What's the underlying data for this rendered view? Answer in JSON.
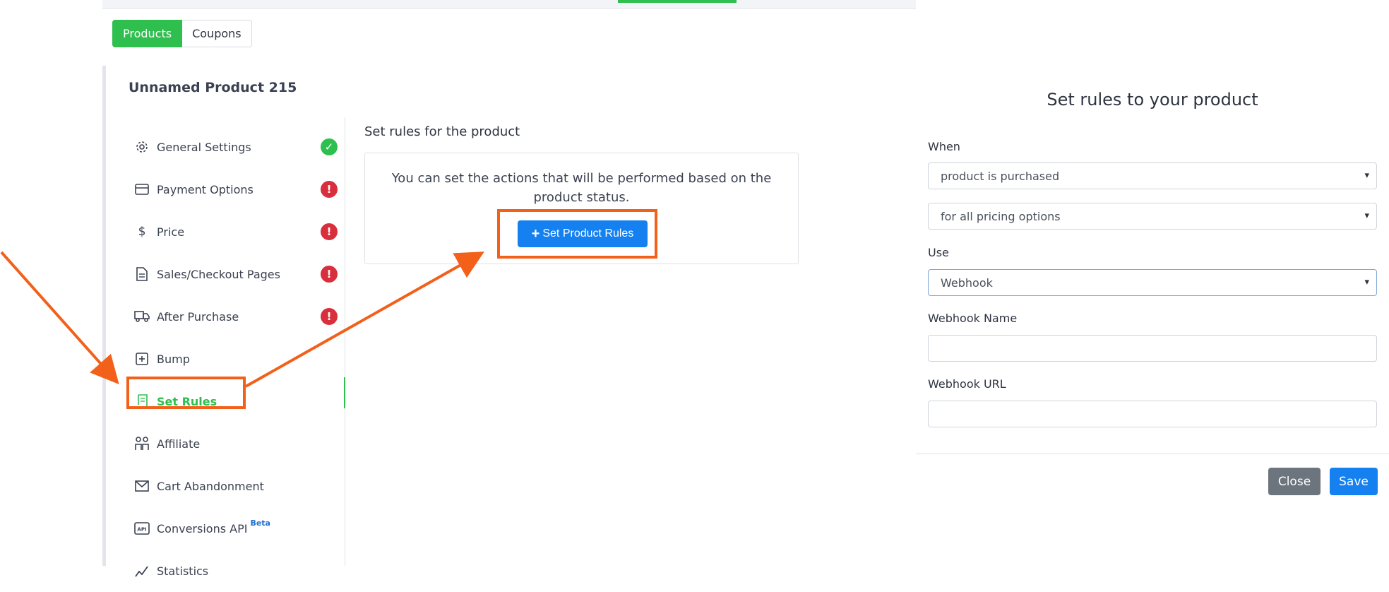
{
  "tabs": [
    {
      "label": "Products",
      "active": true
    },
    {
      "label": "Coupons",
      "active": false
    }
  ],
  "product": {
    "title": "Unnamed Product 215"
  },
  "nav": {
    "general_settings": {
      "label": "General Settings",
      "icon": "gear-icon",
      "status": "complete"
    },
    "payment_options": {
      "label": "Payment Options",
      "icon": "credit-card-icon",
      "status": "incomplete"
    },
    "price": {
      "label": "Price",
      "icon": "dollar-icon",
      "status": "incomplete"
    },
    "sales_checkout": {
      "label": "Sales/Checkout Pages",
      "icon": "document-icon",
      "status": "incomplete"
    },
    "after_purchase": {
      "label": "After Purchase",
      "icon": "truck-icon",
      "status": "incomplete"
    },
    "bump": {
      "label": "Bump",
      "icon": "plus-square-icon"
    },
    "set_rules": {
      "label": "Set Rules",
      "icon": "scroll-icon",
      "active": true
    },
    "affiliate": {
      "label": "Affiliate",
      "icon": "people-icon"
    },
    "cart_abandonment": {
      "label": "Cart Abandonment",
      "icon": "envelope-icon"
    },
    "conversions_api": {
      "label": "Conversions API",
      "icon": "api-icon",
      "badge": "Beta"
    },
    "statistics": {
      "label": "Statistics",
      "icon": "chart-icon"
    }
  },
  "content": {
    "section_title": "Set rules for the product",
    "info_text": "You can set the actions that will be performed based on the product status.",
    "set_rules_button": "Set Product Rules"
  },
  "modal": {
    "title": "Set rules to your product",
    "when_label": "When",
    "when_value": "product is purchased",
    "pricing_value": "for all pricing options",
    "use_label": "Use",
    "use_value": "Webhook",
    "webhook_name_label": "Webhook Name",
    "webhook_name_value": "",
    "webhook_url_label": "Webhook URL",
    "webhook_url_value": "",
    "close_label": "Close",
    "save_label": "Save"
  },
  "colors": {
    "accent_green": "#2fbf4f",
    "primary_blue": "#1580f0",
    "annotation_orange": "#f2601a",
    "error_red": "#d92f3c"
  }
}
